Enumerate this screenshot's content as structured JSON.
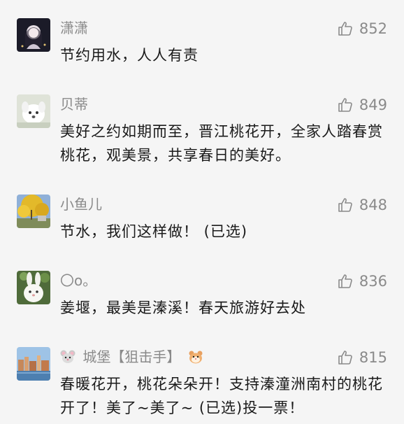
{
  "comments": [
    {
      "name": "潇潇",
      "likes": "852",
      "text": "节约用水，人人有责",
      "avatar_icon": "avatar-anime-girl"
    },
    {
      "name": "贝蒂",
      "likes": "849",
      "text": "美好之约如期而至，晋江桃花开，全家人踏春赏桃花，观美景，共享春日的美好。",
      "avatar_icon": "avatar-white-dog"
    },
    {
      "name": "小鱼儿",
      "likes": "848",
      "text": "节水，我们这样做！ (已选)",
      "avatar_icon": "avatar-yellow-tree"
    },
    {
      "name": "〇o。",
      "likes": "836",
      "text": "姜堰，最美是溱溪！春天旅游好去处",
      "avatar_icon": "avatar-rabbit-plush"
    },
    {
      "name_prefix_icon": "mouse-face-icon",
      "name": "城堡【狙击手】",
      "name_suffix_icon": "hamster-face-icon",
      "likes": "815",
      "text": "春暖花开，桃花朵朵开！支持溱潼洲南村的桃花开了！美了~美了~ (已选)投一票！",
      "avatar_icon": "avatar-city-river"
    }
  ],
  "colors": {
    "background": "#f5f5f5",
    "name": "#8a8a8a",
    "text": "#1a1a1a"
  }
}
